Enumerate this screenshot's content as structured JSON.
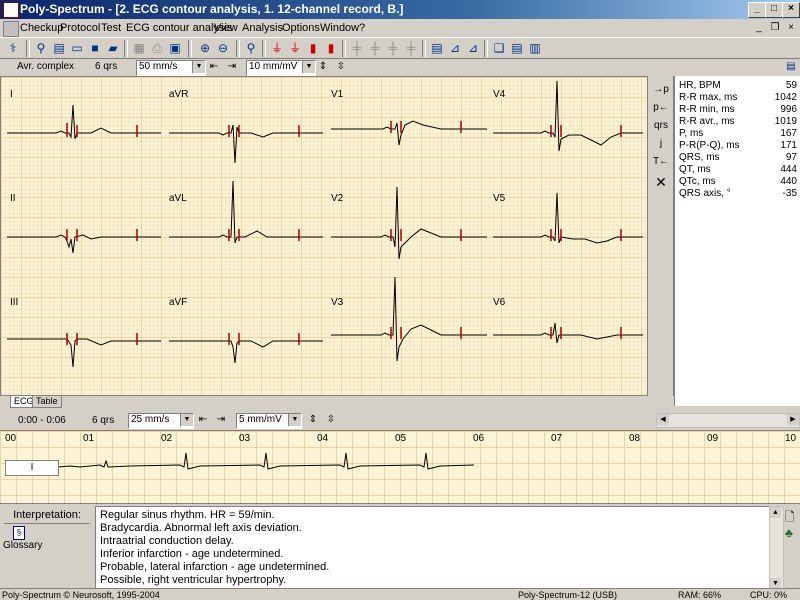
{
  "window": {
    "title": "Poly-Spectrum - [2. ECG contour analysis, 1. 12-channel record, B.]"
  },
  "menu": [
    "Checkup",
    "Protocol",
    "Test",
    "ECG contour analysis",
    "View",
    "Analysis",
    "Options",
    "Window",
    "?"
  ],
  "controls": {
    "label": "Avr. complex",
    "qrs": "6 qrs",
    "speed": "50 mm/s",
    "gain": "10 mm/mV"
  },
  "leads": [
    "I",
    "aVR",
    "V1",
    "V4",
    "II",
    "aVL",
    "V2",
    "V5",
    "III",
    "aVF",
    "V3",
    "V6"
  ],
  "side_buttons": [
    "→p",
    "p←",
    "qrs",
    "j",
    "T←",
    "✕"
  ],
  "params": [
    {
      "name": "HR, BPM",
      "value": "59"
    },
    {
      "name": "R-R max, ms",
      "value": "1042"
    },
    {
      "name": "R-R min, ms",
      "value": "996"
    },
    {
      "name": "R-R avr., ms",
      "value": "1019"
    },
    {
      "name": "P, ms",
      "value": "167"
    },
    {
      "name": "P-R(P-Q), ms",
      "value": "171"
    },
    {
      "name": "QRS, ms",
      "value": "97"
    },
    {
      "name": "QT, ms",
      "value": "444"
    },
    {
      "name": "QTc, ms",
      "value": "440"
    },
    {
      "name": "QRS axis, °",
      "value": "-35"
    }
  ],
  "tabs": [
    "ECG",
    "Table"
  ],
  "controls2": {
    "range": "0:00 - 0:06",
    "qrs": "6 qrs",
    "speed": "25 mm/s",
    "gain": "5 mm/mV"
  },
  "rhythm": {
    "ticks": [
      "00",
      "01",
      "02",
      "03",
      "04",
      "05",
      "06",
      "07",
      "08",
      "09",
      "10"
    ],
    "lead": "I"
  },
  "interpretation": {
    "label": "Interpretation:",
    "glossary": "Glossary",
    "lines": [
      "Regular sinus rhythm. HR = 59/min.",
      "Bradycardia. Abnormal left axis deviation.",
      "Intraatrial conduction delay.",
      "Inferior infarction - age undetermined.",
      "Probable, lateral infarction - age undetermined.",
      "Possible, right ventricular hypertrophy."
    ]
  },
  "status": {
    "copyright": "Poly-Spectrum © Neurosoft, 1995-2004",
    "device": "Poly-Spectrum-12 (USB)",
    "ram": "RAM: 66%",
    "cpu": "CPU: 0%"
  },
  "colors": {
    "grid_bg": "#fbf4d5",
    "grid_major": "#eed1a5",
    "marker": "#b00000",
    "title_bar": "#0a246a"
  }
}
